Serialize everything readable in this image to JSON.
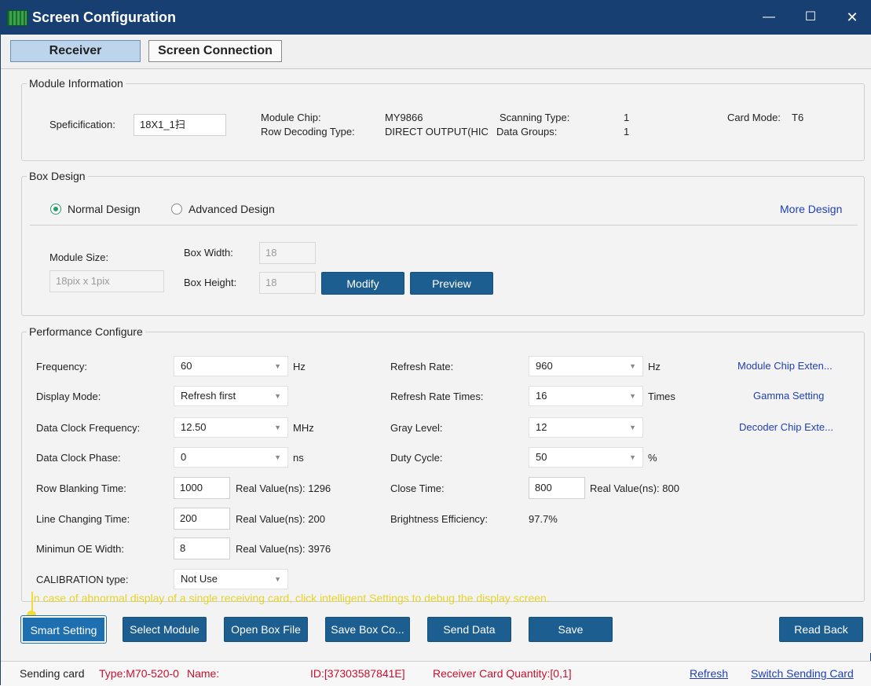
{
  "window": {
    "title": "Screen Configuration",
    "min": "—",
    "max": "☐",
    "close": "✕"
  },
  "tabs": {
    "receiver": "Receiver",
    "screen_connection": "Screen Connection"
  },
  "module_info": {
    "legend": "Module Information",
    "spec_label": "Speficification:",
    "spec_value": "18X1_1扫",
    "chip_label": "Module Chip:",
    "chip_value": "MY9866",
    "row_decoding_label": "Row Decoding Type:",
    "row_decoding_value": "DIRECT OUTPUT(HIC",
    "scanning_label": "Scanning Type:",
    "scanning_value": "1",
    "data_groups_label": "Data Groups:",
    "data_groups_value": "1",
    "card_mode_label": "Card Mode:",
    "card_mode_value": "T6"
  },
  "box_design": {
    "legend": "Box Design",
    "normal": "Normal Design",
    "advanced": "Advanced Design",
    "more": "More Design",
    "module_size_label": "Module Size:",
    "module_size_value": "18pix x 1pix",
    "box_width_label": "Box Width:",
    "box_width_value": "18",
    "box_height_label": "Box Height:",
    "box_height_value": "18",
    "modify": "Modify",
    "preview": "Preview"
  },
  "performance": {
    "legend": "Performance Configure",
    "frequency_label": "Frequency:",
    "frequency_value": "60",
    "frequency_unit": "Hz",
    "display_mode_label": "Display Mode:",
    "display_mode_value": "Refresh first",
    "data_clock_freq_label": "Data Clock Frequency:",
    "data_clock_freq_value": "12.50",
    "data_clock_freq_unit": "MHz",
    "data_clock_phase_label": "Data Clock Phase:",
    "data_clock_phase_value": "0",
    "data_clock_phase_unit": "ns",
    "row_blanking_label": "Row Blanking Time:",
    "row_blanking_value": "1000",
    "row_blanking_real": "Real Value(ns): 1296",
    "line_changing_label": "Line Changing Time:",
    "line_changing_value": "200",
    "line_changing_real": "Real Value(ns): 200",
    "min_oe_label": "Minimun OE Width:",
    "min_oe_value": "8",
    "min_oe_real": "Real Value(ns): 3976",
    "calibration_label": "CALIBRATION type:",
    "calibration_value": "Not Use",
    "refresh_rate_label": "Refresh Rate:",
    "refresh_rate_value": "960",
    "refresh_rate_unit": "Hz",
    "refresh_times_label": "Refresh Rate Times:",
    "refresh_times_value": "16",
    "refresh_times_unit": "Times",
    "gray_level_label": "Gray Level:",
    "gray_level_value": "12",
    "duty_cycle_label": "Duty Cycle:",
    "duty_cycle_value": "50",
    "duty_cycle_unit": "%",
    "close_time_label": "Close Time:",
    "close_time_value": "800",
    "close_time_real": "Real Value(ns): 800",
    "brightness_label": "Brightness Efficiency:",
    "brightness_value": "97.7%",
    "link_module_chip": "Module Chip Exten...",
    "link_gamma": "Gamma Setting",
    "link_decoder_chip": "Decoder Chip Exte..."
  },
  "tip": "In case of abnormal display of a single receiving card, click intelligent Settings to debug the display screen.",
  "buttons": {
    "smart_setting": "Smart Setting",
    "select_module": "Select Module",
    "open_box_file": "Open Box File",
    "save_box_config": "Save Box Co...",
    "send_data": "Send Data",
    "save": "Save",
    "read_back": "Read Back"
  },
  "status": {
    "sending_card": "Sending card",
    "type": "Type:M70-520-0",
    "name": "Name:",
    "id": "ID:[37303587841E]",
    "receiver_qty": "Receiver Card Quantity:[0,1]",
    "refresh": "Refresh",
    "switch": "Switch Sending Card"
  },
  "colors": {
    "title_bar": "#183f71",
    "button": "#1c5e8f",
    "link": "#1f3fb5",
    "tip": "#e6d32a",
    "status_red": "#c8102e"
  }
}
